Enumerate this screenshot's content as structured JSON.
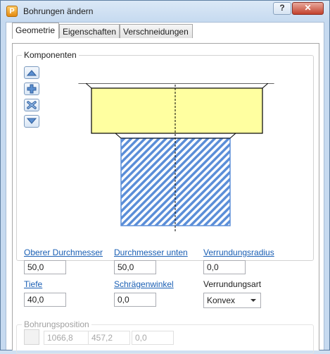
{
  "window": {
    "title": "Bohrungen ändern",
    "app_icon_letter": "P",
    "help_label": "?",
    "close_label": "✕"
  },
  "tabs": [
    {
      "label": "Geometrie",
      "active": true
    },
    {
      "label": "Eigenschaften",
      "active": false
    },
    {
      "label": "Verschneidungen",
      "active": false
    }
  ],
  "components": {
    "label": "Komponenten",
    "buttons": [
      "move-up-icon",
      "add-icon",
      "delete-icon",
      "move-down-icon"
    ],
    "colors": {
      "counterbore_fill": "#ffffa0",
      "hole_hatch": "#5b8ed8",
      "outline": "#000000"
    }
  },
  "fields": {
    "upper_diameter": {
      "label": "Oberer Durchmesser",
      "value": "50,0"
    },
    "lower_diameter": {
      "label": "Durchmesser unten",
      "value": "50,0"
    },
    "fillet_radius": {
      "label": "Verrundungsradius",
      "value": "0,0"
    },
    "depth": {
      "label": "Tiefe",
      "value": "40,0"
    },
    "draft_angle": {
      "label": "Schrägenwinkel",
      "value": "0,0"
    },
    "fillet_type": {
      "label": "Verrundungsart",
      "value": "Konvex"
    }
  },
  "hole_position": {
    "label": "Bohrungsposition",
    "x": "1066,8",
    "y": "457,2",
    "z": "0,0"
  }
}
